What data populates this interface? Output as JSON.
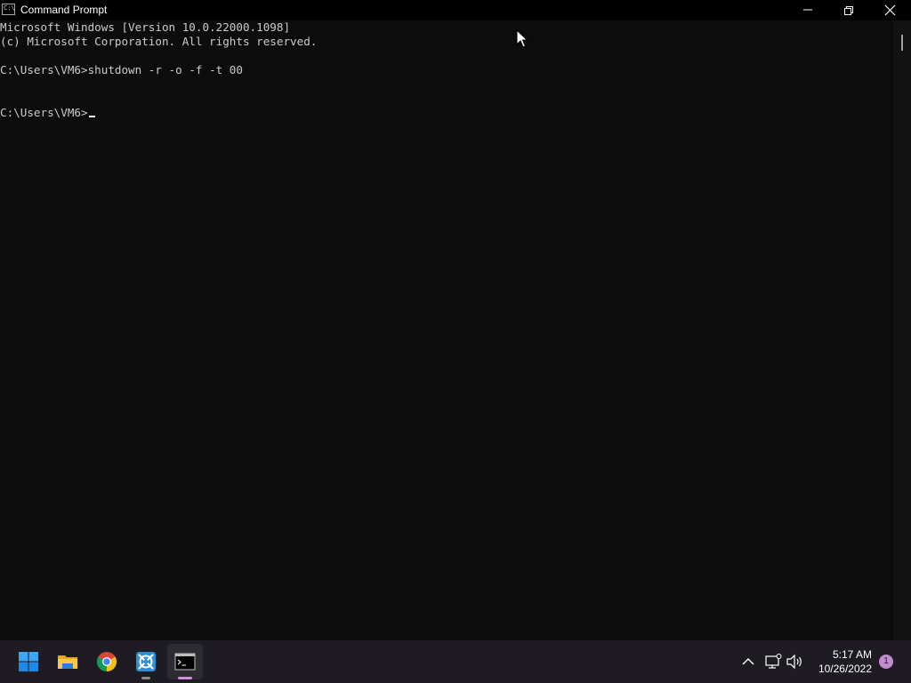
{
  "window": {
    "title": "Command Prompt",
    "icon_label": "C:\\"
  },
  "console": {
    "lines": [
      "Microsoft Windows [Version 10.0.22000.1098]",
      "(c) Microsoft Corporation. All rights reserved.",
      "",
      "C:\\Users\\VM6>shutdown -r -o -f -t 00",
      "",
      "",
      "C:\\Users\\VM6>"
    ]
  },
  "taskbar": {
    "pinned": [
      {
        "name": "start",
        "icon": "windows-logo-icon"
      },
      {
        "name": "file-explorer",
        "icon": "folder-icon"
      },
      {
        "name": "chrome",
        "icon": "chrome-icon"
      },
      {
        "name": "app",
        "icon": "gear-app-icon"
      },
      {
        "name": "command-prompt",
        "icon": "terminal-icon"
      }
    ],
    "tray": {
      "time": "5:17 AM",
      "date": "10/26/2022",
      "notification_count": "1"
    }
  },
  "colors": {
    "console_bg": "#0c0c0c",
    "console_text": "#cccccc",
    "taskbar_bg": "#1e1c22",
    "accent": "#cf92d8"
  }
}
